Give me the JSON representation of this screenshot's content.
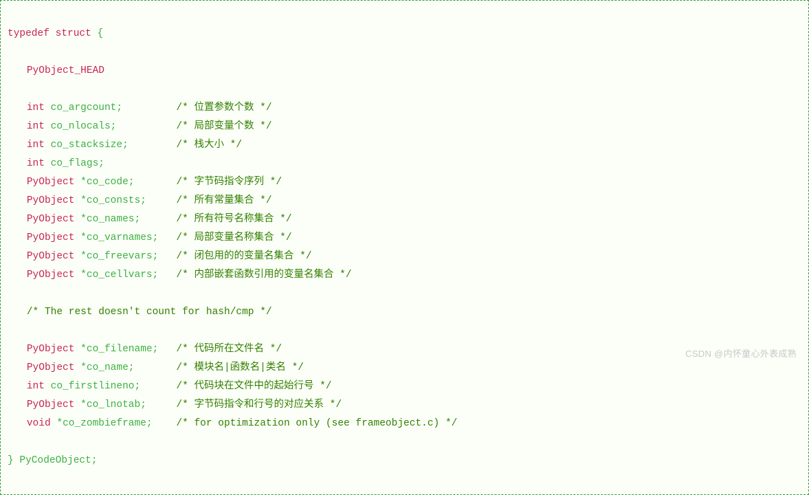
{
  "header": {
    "typedef": "typedef",
    "struct": "struct",
    "open": "{"
  },
  "pyobject_head": "PyObject_HEAD",
  "fields": [
    {
      "type": "int",
      "name": "co_argcount",
      "comment": "位置参数个数"
    },
    {
      "type": "int",
      "name": "co_nlocals",
      "comment": "局部变量个数"
    },
    {
      "type": "int",
      "name": "co_stacksize",
      "comment": "栈大小"
    },
    {
      "type": "int",
      "name": "co_flags",
      "comment": null
    },
    {
      "type": "PyObject",
      "ptr": true,
      "name": "co_code",
      "comment": "字节码指令序列"
    },
    {
      "type": "PyObject",
      "ptr": true,
      "name": "co_consts",
      "comment": "所有常量集合"
    },
    {
      "type": "PyObject",
      "ptr": true,
      "name": "co_names",
      "comment": "所有符号名称集合"
    },
    {
      "type": "PyObject",
      "ptr": true,
      "name": "co_varnames",
      "comment": "局部变量名称集合"
    },
    {
      "type": "PyObject",
      "ptr": true,
      "name": "co_freevars",
      "comment": "闭包用的的变量名集合"
    },
    {
      "type": "PyObject",
      "ptr": true,
      "name": "co_cellvars",
      "comment": "内部嵌套函数引用的变量名集合"
    }
  ],
  "mid_comment": "The rest doesn't count for hash/cmp",
  "fields2": [
    {
      "type": "PyObject",
      "ptr": true,
      "name": "co_filename",
      "comment": "代码所在文件名"
    },
    {
      "type": "PyObject",
      "ptr": true,
      "name": "co_name",
      "comment": "模块名|函数名|类名"
    },
    {
      "type": "int",
      "name": "co_firstlineno",
      "comment": "代码块在文件中的起始行号"
    },
    {
      "type": "PyObject",
      "ptr": true,
      "name": "co_lnotab",
      "comment": "字节码指令和行号的对应关系"
    },
    {
      "type": "void",
      "ptr": true,
      "name": "co_zombieframe",
      "comment": "for optimization only (see frameobject.c)"
    }
  ],
  "footer": {
    "close": "}",
    "typename": "PyCodeObject",
    "semi": ";"
  },
  "watermark": "CSDN @内怀童心外表成熟"
}
